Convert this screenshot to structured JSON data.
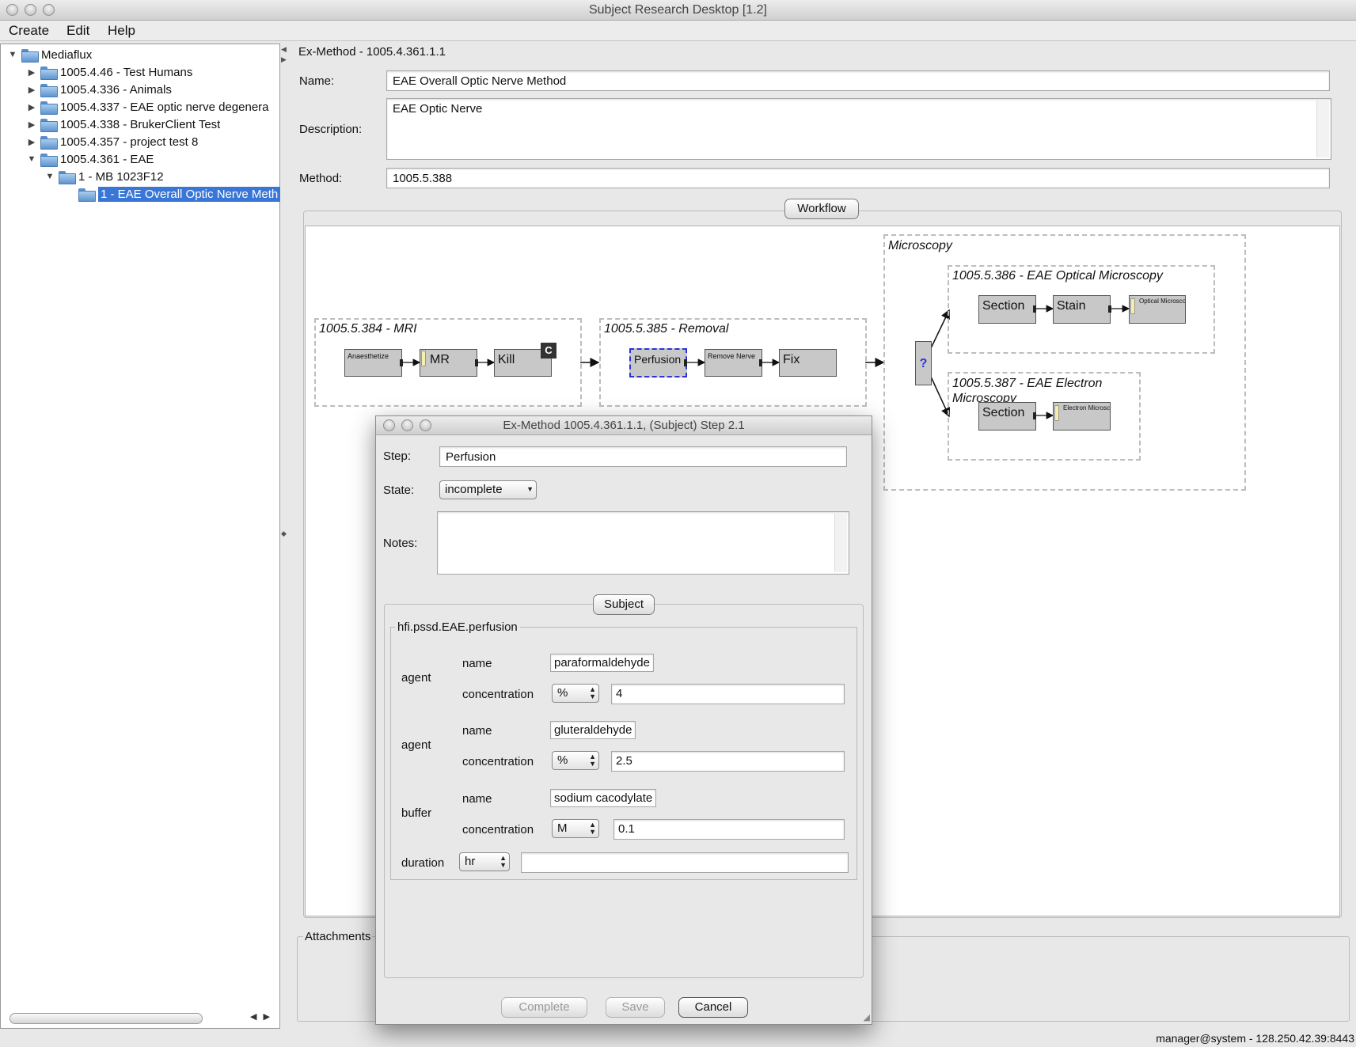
{
  "window": {
    "title": "Subject Research Desktop [1.2]"
  },
  "menu": {
    "items": [
      "Create",
      "Edit",
      "Help"
    ]
  },
  "tree": {
    "root": "Mediaflux",
    "items": [
      {
        "label": "1005.4.46 - Test Humans"
      },
      {
        "label": "1005.4.336 - Animals"
      },
      {
        "label": "1005.4.337 - EAE optic nerve degenera"
      },
      {
        "label": "1005.4.338 - BrukerClient Test"
      },
      {
        "label": "1005.4.357 - project test 8"
      },
      {
        "label": "1005.4.361 - EAE"
      },
      {
        "label": "1 - MB 1023F12"
      },
      {
        "label": "1 - EAE Overall Optic Nerve Meth"
      }
    ]
  },
  "main": {
    "section_title": "Ex-Method - 1005.4.361.1.1",
    "name_label": "Name:",
    "name_value": "EAE Overall Optic Nerve Method",
    "description_label": "Description:",
    "description_value": "EAE Optic Nerve",
    "method_label": "Method:",
    "method_value": "1005.5.388",
    "workflow_button": "Workflow",
    "attachments_label": "Attachments"
  },
  "workflow": {
    "mri": {
      "title": "1005.5.384 - MRI",
      "steps": [
        "Anaesthetize",
        "MR",
        "Kill"
      ],
      "badge": "C"
    },
    "removal": {
      "title": "1005.5.385 - Removal",
      "steps": [
        "Perfusion",
        "Remove Nerve",
        "Fix"
      ]
    },
    "microscopy": {
      "title": "Microscopy",
      "decision": "?",
      "optical": {
        "title": "1005.5.386 - EAE Optical Microscopy",
        "steps": [
          "Section",
          "Stain",
          "Optical Microscopy"
        ]
      },
      "electron": {
        "title": "1005.5.387 - EAE  Electron Microscopy",
        "steps": [
          "Section",
          "Electron Microscopy"
        ]
      }
    }
  },
  "dialog": {
    "title": "Ex-Method 1005.4.361.1.1, (Subject) Step 2.1",
    "step_label": "Step:",
    "step_value": "Perfusion",
    "state_label": "State:",
    "state_value": "incomplete",
    "notes_label": "Notes:",
    "notes_value": "",
    "subject_button": "Subject",
    "meta_title": "hfi.pssd.EAE.perfusion",
    "name_label": "name",
    "concentration_label": "concentration",
    "agent1": {
      "label": "agent",
      "name": "paraformaldehyde",
      "unit": "%",
      "value": "4"
    },
    "agent2": {
      "label": "agent",
      "name": "gluteraldehyde",
      "unit": "%",
      "value": "2.5"
    },
    "buffer": {
      "label": "buffer",
      "name": "sodium cacodylate",
      "unit": "M",
      "value": "0.1"
    },
    "duration": {
      "label": "duration",
      "unit": "hr",
      "value": ""
    },
    "buttons": {
      "complete": "Complete",
      "save": "Save",
      "cancel": "Cancel"
    }
  },
  "status": {
    "text": "manager@system - 128.250.42.39:8443"
  }
}
